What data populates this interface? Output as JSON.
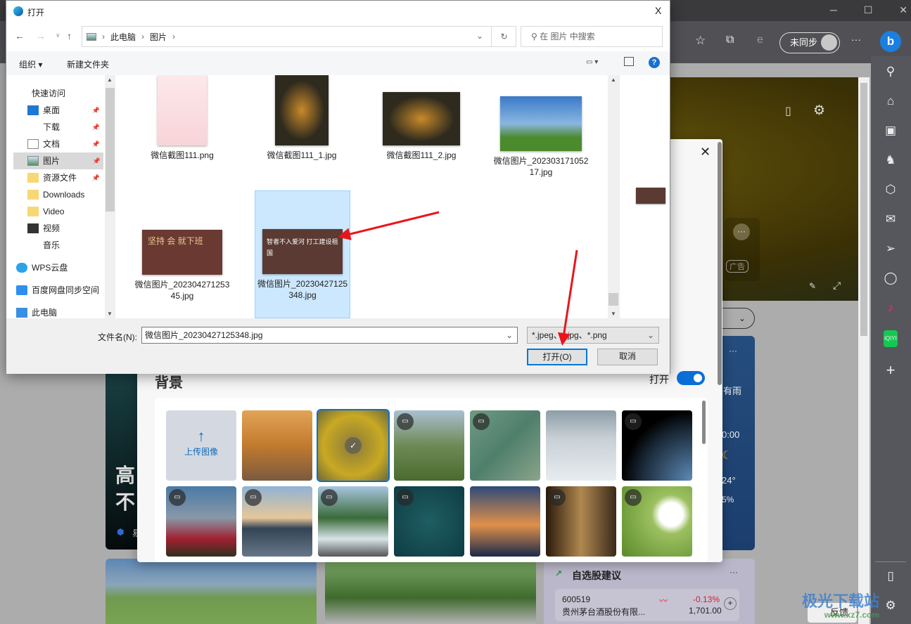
{
  "browser": {
    "sync_label": "未同步",
    "more": "···",
    "ad_label": "广告",
    "hero_more": "···"
  },
  "left_card": {
    "line1": "高",
    "line2": "不",
    "source": "易"
  },
  "weather_card": {
    "more": "···",
    "link": "有雨",
    "time": "0:00",
    "temp": "24°",
    "humidity": "5%"
  },
  "stocks_card": {
    "title": "自选股建议",
    "more": "···",
    "code": "600519",
    "name": "贵州茅台酒股份有限...",
    "change": "-0.13%",
    "price": "1,701.00"
  },
  "feedback": {
    "label": "反馈"
  },
  "watermark": {
    "text": "极光下载站",
    "url": "www.xz7.com"
  },
  "settings_panel": {
    "section_title": "背景",
    "toggle_label": "打开",
    "toggle_on": true,
    "upload_label": "上传图像",
    "close": "✕"
  },
  "dialog": {
    "title": "打开",
    "close": "X",
    "breadcrumb": [
      "此电脑",
      "图片"
    ],
    "search_placeholder": "在 图片 中搜索",
    "toolbar": {
      "organize": "组织 ▾",
      "new_folder": "新建文件夹"
    },
    "nav": [
      {
        "label": "快速访问",
        "icon": "star-icon"
      },
      {
        "label": "桌面",
        "icon": "desktop-icon",
        "pinned": true
      },
      {
        "label": "下载",
        "icon": "download-icon",
        "pinned": true
      },
      {
        "label": "文档",
        "icon": "document-icon",
        "pinned": true
      },
      {
        "label": "图片",
        "icon": "pictures-icon",
        "pinned": true,
        "selected": true
      },
      {
        "label": "资源文件",
        "icon": "folder-icon",
        "pinned": true
      },
      {
        "label": "Downloads",
        "icon": "folder-icon"
      },
      {
        "label": "Video",
        "icon": "folder-icon"
      },
      {
        "label": "视频",
        "icon": "video-icon"
      },
      {
        "label": "音乐",
        "icon": "music-icon"
      },
      {
        "label": "WPS云盘",
        "icon": "cloud-icon"
      },
      {
        "label": "百度网盘同步空间",
        "icon": "baidu-icon"
      },
      {
        "label": "此电脑",
        "icon": "computer-icon"
      }
    ],
    "files": [
      {
        "name": "微信截图111.png"
      },
      {
        "name": "微信截图111_1.jpg"
      },
      {
        "name": "微信截图111_2.jpg"
      },
      {
        "name": "微信图片_20230317105217.jpg"
      },
      {
        "name": "微信图片_20230427125345.jpg",
        "thumb_text": "坚持 会 就下班"
      },
      {
        "name": "微信图片_20230427125348.jpg",
        "thumb_text": "智者不入爱河 打工建设祖国",
        "selected": true
      }
    ],
    "filename_label": "文件名(N):",
    "filename_value": "微信图片_20230427125348.jpg",
    "filter_value": "*.jpeg、*.jpg、*.png",
    "open_button": "打开(O)",
    "cancel_button": "取消"
  }
}
